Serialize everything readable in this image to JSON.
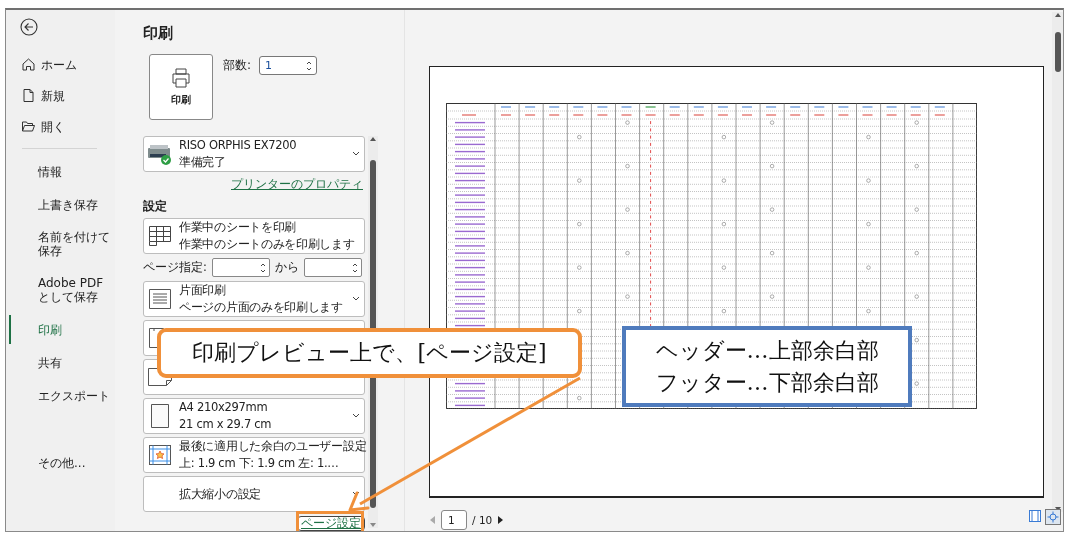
{
  "nav": {
    "items": [
      {
        "kind": "home",
        "label": "ホーム",
        "selected": false
      },
      {
        "kind": "new",
        "label": "新規",
        "selected": false
      },
      {
        "kind": "open",
        "label": "開く",
        "selected": false
      },
      {
        "kind": "text",
        "label": "情報",
        "selected": false
      },
      {
        "kind": "text",
        "label": "上書き保存",
        "selected": false
      },
      {
        "kind": "text",
        "label": "名前を付けて保存",
        "selected": false
      },
      {
        "kind": "text",
        "label": "Adobe PDF として保存",
        "selected": false
      },
      {
        "kind": "text",
        "label": "印刷",
        "selected": true
      },
      {
        "kind": "text",
        "label": "共有",
        "selected": false
      },
      {
        "kind": "text",
        "label": "エクスポート",
        "selected": false
      },
      {
        "kind": "more",
        "label": "その他...",
        "selected": false
      }
    ]
  },
  "print": {
    "title": "印刷",
    "print_button": "印刷",
    "copies": {
      "label": "部数:",
      "value": "1"
    },
    "printer": {
      "name": "RISO ORPHIS EX7200",
      "status": "準備完了"
    },
    "printer_properties": "プリンターのプロパティ",
    "settings_heading": "設定",
    "settings": [
      {
        "kind": "sheets",
        "line1": "作業中のシートを印刷",
        "line2": "作業中のシートのみを印刷します"
      },
      {
        "kind": "range",
        "label": "ページ指定:",
        "to": "から"
      },
      {
        "kind": "sides",
        "line1": "片面印刷",
        "line2": "ページの片面のみを印刷します"
      },
      {
        "kind": "collate"
      },
      {
        "kind": "orientation"
      },
      {
        "kind": "paper",
        "line1": "A4 210x297mm",
        "line2": "21 cm x 29.7 cm"
      },
      {
        "kind": "margins",
        "line1": "最後に適用した余白のユーザー設定",
        "line2": "上: 1.9 cm 下: 1.9 cm 左: 1.…"
      },
      {
        "kind": "scaling",
        "line1": "拡大縮小の設定"
      }
    ],
    "page_setup": "ページ設定"
  },
  "preview": {
    "page": "1",
    "total": "/ 10"
  },
  "callouts": [
    {
      "kind": "pointer",
      "lines": [
        "印刷プレビュー上で、[ページ設定]"
      ],
      "color": "#f0903a"
    },
    {
      "kind": "note",
      "lines": [
        "ヘッダー…上部余白部",
        "フッター…下部余白部"
      ],
      "color": "#4f7bbd"
    }
  ]
}
